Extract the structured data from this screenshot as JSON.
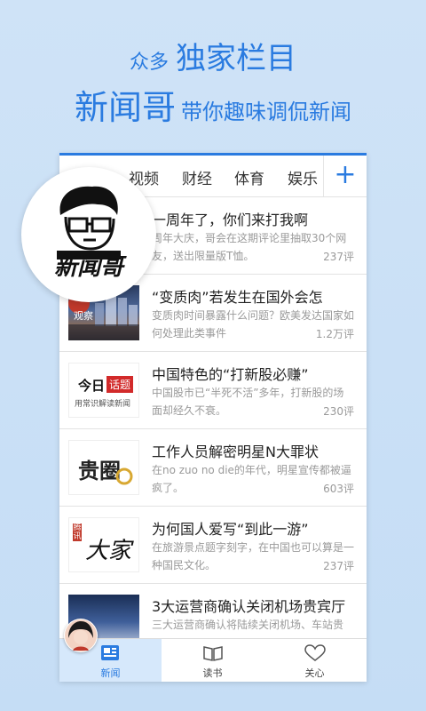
{
  "promo": {
    "line1_small": "众多",
    "line1_big": "独家栏目",
    "line2_big": "新闻哥",
    "line2_small": "带你趣味调侃新闻"
  },
  "tabs": {
    "items": [
      "视频",
      "财经",
      "体育",
      "娱乐"
    ],
    "add_label": "+"
  },
  "articles": [
    {
      "title": "一周年了，你们来打我啊",
      "summary": "周年大庆，哥会在这期评论里抽取30个网友，送出限量版T恤。",
      "count": "237评"
    },
    {
      "title": "“变质肉”若发生在国外会怎",
      "summary": "变质肉时间暴露什么问题？欧美发达国家如何处理此类事件",
      "count": "1.2万评"
    },
    {
      "title": "中国特色的“打新股必赚”",
      "summary": "中国股市已“半死不活”多年，打新股的场面却经久不衰。",
      "count": "230评"
    },
    {
      "title": "工作人员解密明星N大罪状",
      "summary": "在no zuo no die的年代，明星宣传都被逼疯了。",
      "count": "603评"
    },
    {
      "title": "为何国人爱写“到此一游”",
      "summary": "在旅游景点题字刻字，在中国也可以算是一种国民文化。",
      "count": "237评"
    },
    {
      "title": "3大运营商确认关闭机场贵宾厅",
      "summary": "三大运营商确认将陆续关闭机场、车站贵",
      "count": ""
    }
  ],
  "thumbs": {
    "xinwenge": "新闻哥",
    "guancha": "观察",
    "jinri": "今日",
    "huati": "话题",
    "jinri_sub": "用常识解读新闻",
    "guiquan": "贵圈",
    "dajia": "大家",
    "dajia_side": "腾讯"
  },
  "bottom_nav": [
    {
      "label": "新闻",
      "icon": "news-icon"
    },
    {
      "label": "读书",
      "icon": "book-icon"
    },
    {
      "label": "关心",
      "icon": "heart-icon"
    }
  ],
  "colors": {
    "accent": "#2a7be0",
    "background": "#c9e0f6"
  }
}
